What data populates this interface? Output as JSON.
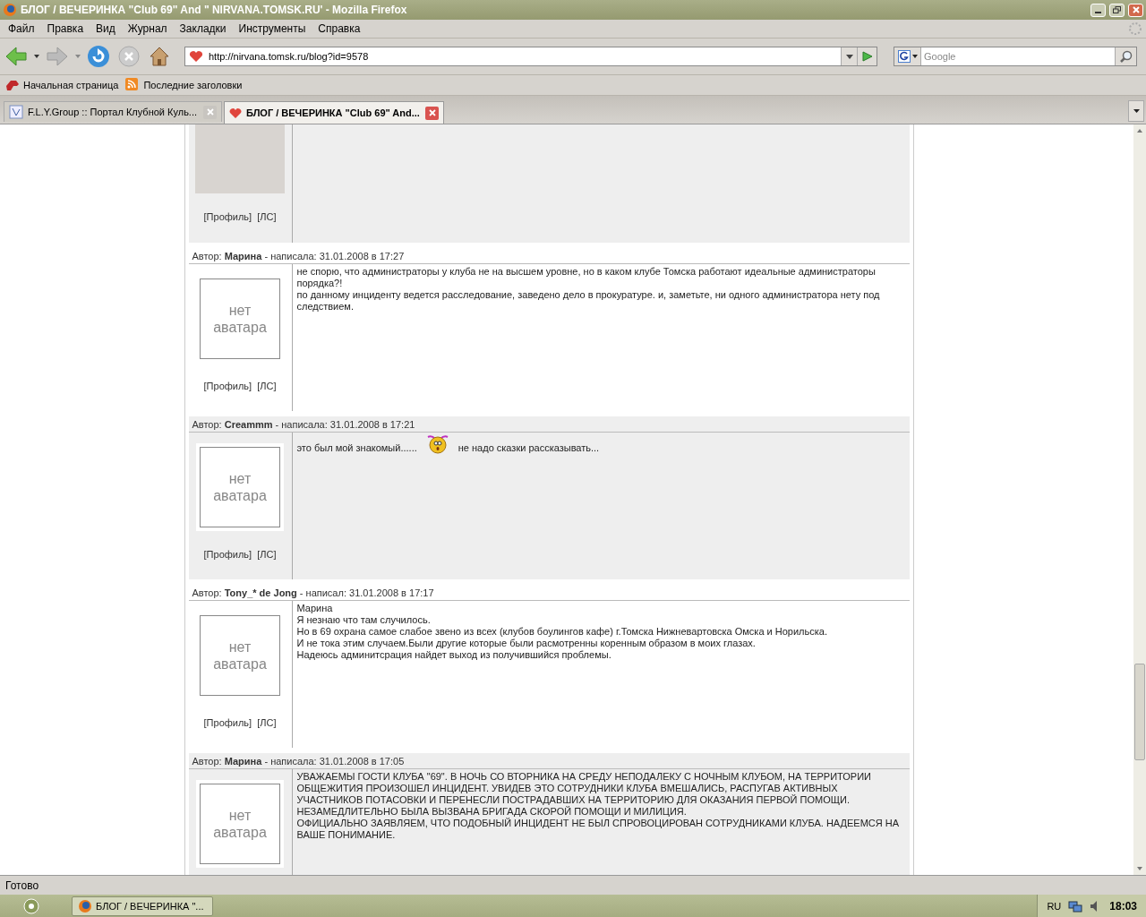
{
  "window": {
    "title": "БЛОГ / ВЕЧЕРИНКА \"Club 69\" And \" NIRVANA.TOMSK.RU' - Mozilla Firefox"
  },
  "menu": [
    "Файл",
    "Правка",
    "Вид",
    "Журнал",
    "Закладки",
    "Инструменты",
    "Справка"
  ],
  "address": {
    "value": "http://nirvana.tomsk.ru/blog?id=9578"
  },
  "search": {
    "placeholder": "Google"
  },
  "bookmarks": [
    {
      "kind": "home",
      "label": "Начальная страница"
    },
    {
      "kind": "rss",
      "label": "Последние заголовки"
    }
  ],
  "tabs": [
    {
      "label": "F.L.Y.Group :: Портал Клубной Куль...",
      "selected": false
    },
    {
      "label": "БЛОГ / ВЕЧЕРИНКА \"Club 69\" And...",
      "selected": true
    }
  ],
  "posts": [
    {
      "shaded": true,
      "has_avatar": true,
      "links": [
        "[Профиль]",
        "[ЛС]"
      ]
    },
    {
      "shaded": false,
      "header": "Автор: **Марина** - написала: 31.01.2008 в 17:27",
      "has_avatar": false,
      "avatar_text": "нет аватара",
      "links": [
        "[Профиль]",
        "[ЛС]"
      ],
      "body": [
        [
          {
            "kind": "text",
            "text": "не спорю, что администраторы у клуба не на высшем уровне, но в каком клубе Томска работают идеальные администраторы порядка?!"
          }
        ],
        [
          {
            "kind": "text",
            "text": "по данному инциденту ведется расследование, заведено дело в прокуратуре. и, заметьте, ни одного администратора нету под следствием."
          }
        ]
      ]
    },
    {
      "shaded": true,
      "header": "Автор: **Creammm** - написала: 31.01.2008 в 17:21",
      "has_avatar": false,
      "avatar_text": "нет аватара",
      "links": [
        "[Профиль]",
        "[ЛС]"
      ],
      "body": [
        [
          {
            "kind": "text",
            "text": "это был мой знакомый......"
          },
          {
            "kind": "smiley"
          },
          {
            "kind": "text",
            "text": "не надо сказки рассказывать..."
          }
        ]
      ]
    },
    {
      "shaded": false,
      "header": "Автор: **Tony_* de Jong** - написал: 31.01.2008 в 17:17",
      "has_avatar": false,
      "avatar_text": "нет аватара",
      "links": [
        "[Профиль]",
        "[ЛС]"
      ],
      "body": [
        [
          {
            "kind": "text",
            "text": "Марина"
          }
        ],
        [
          {
            "kind": "text",
            "text": "Я незнаю что там случилось."
          }
        ],
        [
          {
            "kind": "text",
            "text": "Но в 69 охрана самое слабое звено из всех (клубов боулингов кафе) г.Томска Нижневартовска Омска и Норильска."
          }
        ],
        [
          {
            "kind": "text",
            "text": "И не тока этим случаем.Были другие которые были расмотренны коренным образом в моих глазах."
          }
        ],
        [
          {
            "kind": "text",
            "text": "Надеюсь админитсрация найдет выход из получившийся проблемы."
          }
        ]
      ]
    },
    {
      "shaded": true,
      "header": "Автор: **Марина** - написала: 31.01.2008 в 17:05",
      "has_avatar": false,
      "avatar_text": "нет аватара",
      "body": [
        [
          {
            "kind": "text",
            "text": "УВАЖАЕМЫ ГОСТИ КЛУБА \"69\". В НОЧЬ СО ВТОРНИКА НА СРЕДУ НЕПОДАЛЕКУ С НОЧНЫМ КЛУБОМ, НА ТЕРРИТОРИИ ОБЩЕЖИТИЯ ПРОИЗОШЕЛ ИНЦИДЕНТ. УВИДЕВ ЭТО СОТРУДНИКИ КЛУБА ВМЕШАЛИСЬ, РАСПУГАВ АКТИВНЫХ УЧАСТНИКОВ ПОТАСОВКИ И ПЕРЕНЕСЛИ ПОСТРАДАВШИХ НА ТЕРРИТОРИЮ ДЛЯ ОКАЗАНИЯ ПЕРВОЙ ПОМОЩИ. НЕЗАМЕДЛИТЕЛЬНО БЫЛА ВЫЗВАНА БРИГАДА СКОРОЙ ПОМОЩИ И МИЛИЦИЯ."
          }
        ],
        [
          {
            "kind": "text",
            "text": "ОФИЦИАЛЬНО ЗАЯВЛЯЕМ, ЧТО ПОДОБНЫЙ ИНЦИДЕНТ НЕ БЫЛ СПРОВОЦИРОВАН СОТРУДНИКАМИ КЛУБА. НАДЕЕМСЯ НА ВАШЕ ПОНИМАНИЕ."
          }
        ]
      ]
    }
  ],
  "status_bar": "Готово",
  "taskbar": {
    "task": "БЛОГ / ВЕЧЕРИНКА \"...",
    "language": "RU",
    "clock": "18:03"
  }
}
